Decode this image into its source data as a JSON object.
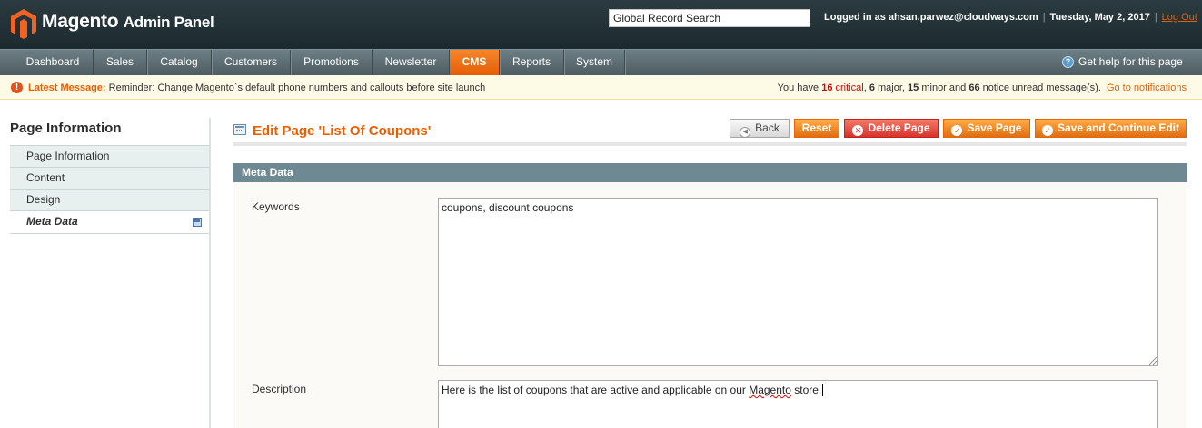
{
  "header": {
    "brand": "Magento",
    "brand_suffix": "Admin Panel",
    "search_value": "Global Record Search",
    "logged_in": "Logged in as ahsan.parwez@cloudways.com",
    "date": "Tuesday, May 2, 2017",
    "logout": "Log Out"
  },
  "nav": {
    "items": [
      {
        "label": "Dashboard"
      },
      {
        "label": "Sales"
      },
      {
        "label": "Catalog"
      },
      {
        "label": "Customers"
      },
      {
        "label": "Promotions"
      },
      {
        "label": "Newsletter"
      },
      {
        "label": "CMS"
      },
      {
        "label": "Reports"
      },
      {
        "label": "System"
      }
    ],
    "active": "CMS",
    "help": "Get help for this page"
  },
  "message": {
    "prefix": "Latest Message:",
    "text": "Reminder: Change Magento`s default phone numbers and callouts before site launch",
    "counts_intro": "You have",
    "critical_count": "16",
    "critical_label": "critical",
    "major_count": "6",
    "major_label": "major,",
    "minor_count": "15",
    "minor_label": "minor and",
    "notice_count": "66",
    "notice_label": "notice unread message(s).",
    "notifications_link": "Go to notifications"
  },
  "sidebar": {
    "title": "Page Information",
    "tabs": [
      {
        "label": "Page Information"
      },
      {
        "label": "Content"
      },
      {
        "label": "Design"
      },
      {
        "label": "Meta Data"
      }
    ]
  },
  "main": {
    "title": "Edit Page 'List Of Coupons'",
    "buttons": {
      "back": "Back",
      "reset": "Reset",
      "delete": "Delete Page",
      "save": "Save Page",
      "save_continue": "Save and Continue Edit"
    },
    "fieldset_title": "Meta Data",
    "keywords_label": "Keywords",
    "keywords_value": "coupons, discount coupons",
    "description_label": "Description",
    "description_before": "Here is the list of coupons that are active and applicable on our ",
    "description_misspelled": "Magento",
    "description_after": " store."
  },
  "colors": {
    "accent": "#eb5e00",
    "nav_bg": "#5d6e73",
    "header_bg": "#23333a",
    "fieldset_header": "#6f8992"
  }
}
